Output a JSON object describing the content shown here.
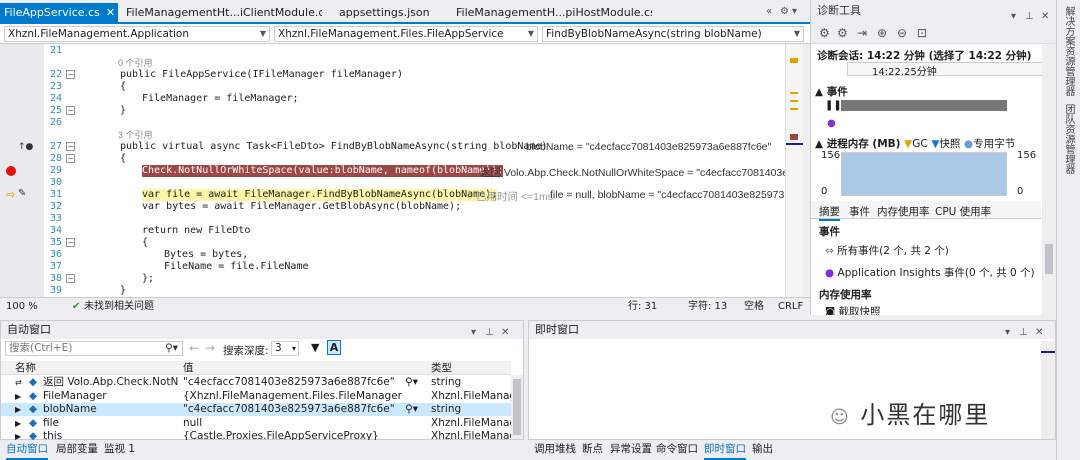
{
  "tabs": [
    {
      "label": "FileAppService.cs",
      "active": true
    },
    {
      "label": "FileManagementHt...iClientModule.cs",
      "active": false
    },
    {
      "label": "appsettings.json",
      "active": false
    },
    {
      "label": "FileManagementH...piHostModule.cs",
      "active": false
    }
  ],
  "tab_controls": [
    "«",
    "⚙",
    "▾",
    "⊞"
  ],
  "nav": {
    "project": "Xhznl.FileManagement.Application",
    "class": "Xhznl.FileManagement.Files.FileAppService",
    "member": "FindByBlobNameAsync(string blobName)"
  },
  "lines": [
    {
      "n": "21",
      "t": ""
    },
    {
      "n": "",
      "t": "0 个引用",
      "cls": "cm"
    },
    {
      "n": "22",
      "t": "public FileAppService(IFileManager fileManager)"
    },
    {
      "n": "23",
      "t": "{"
    },
    {
      "n": "24",
      "t": "    FileManager = fileManager;"
    },
    {
      "n": "25",
      "t": "}"
    },
    {
      "n": "26",
      "t": ""
    },
    {
      "n": "",
      "t": "3 个引用",
      "cls": "cm"
    },
    {
      "n": "27",
      "t": "public virtual async Task<FileDto> FindByBlobNameAsync(string blobName)"
    },
    {
      "n": "28",
      "t": "{"
    },
    {
      "n": "29",
      "t": "    Check.NotNullOrWhiteSpace(value:blobName, nameof(blobName));"
    },
    {
      "n": "30",
      "t": ""
    },
    {
      "n": "31",
      "t": "    var file = await FileManager.FindByBlobNameAsync(blobName);"
    },
    {
      "n": "32",
      "t": "    var bytes = await FileManager.GetBlobAsync(blobName);"
    },
    {
      "n": "33",
      "t": ""
    },
    {
      "n": "34",
      "t": "    return new FileDto"
    },
    {
      "n": "35",
      "t": "    {"
    },
    {
      "n": "36",
      "t": "        Bytes = bytes,"
    },
    {
      "n": "37",
      "t": "        FileName = file.FileName"
    },
    {
      "n": "38",
      "t": "    };"
    },
    {
      "n": "39",
      "t": "}"
    }
  ],
  "datatips": {
    "line27": "blobName = \"c4ecfacc7081403e825973a6e887fc6e\"",
    "line29": "返回 Volo.Abp.Check.NotNullOrWhiteSpace = \"c4ecfacc7081403e82",
    "line31_time": "已用时间 <=1ms",
    "line31": "file = null,  blobName = \"c4ecfacc7081403e825973"
  },
  "status": {
    "zoom": "100 %",
    "issues": "未找到相关问题",
    "row": "行: 31",
    "char": "字符: 13",
    "space": "空格",
    "eol": "CRLF"
  },
  "diag": {
    "title": "诊断工具",
    "session": "诊断会话: 14:22 分钟 (选择了 14:22 分钟)",
    "time_label": "14:22.25分钟",
    "events_label": "事件",
    "memory_label": "进程内存 (MB)",
    "legend_gc": "GC",
    "legend_snapshot": "快照",
    "legend_private": "专用字节",
    "mem_left": "156",
    "mem_right": "156",
    "mem_bottom_left": "0",
    "mem_bottom_right": "0",
    "subtabs": [
      "摘要",
      "事件",
      "内存使用率",
      "CPU 使用率"
    ],
    "section_events": "事件",
    "all_events": "所有事件(2 个, 共 2 个)",
    "app_insights": "Application Insights 事件(0 个, 共 0 个)",
    "section_memory": "内存使用率",
    "snapshot": "截取快照"
  },
  "right_sidebar": [
    "解决方案资源管理器",
    "团队资源管理器"
  ],
  "autos": {
    "title": "自动窗口",
    "search_placeholder": "搜索(Ctrl+E)",
    "depth_label": "搜索深度:",
    "depth_value": "3",
    "columns": [
      "名称",
      "值",
      "类型"
    ],
    "rows": [
      {
        "name": "返回 Volo.Abp.Check.NotNull...",
        "value": "\"c4ecfacc7081403e825973a6e887fc6e\"",
        "type": "string"
      },
      {
        "name": "FileManager",
        "value": "{Xhznl.FileManagement.Files.FileManager}",
        "type": "Xhznl.FileManag..."
      },
      {
        "name": "blobName",
        "value": "\"c4ecfacc7081403e825973a6e887fc6e\"",
        "type": "string"
      },
      {
        "name": "file",
        "value": "null",
        "type": "Xhznl.FileManag..."
      },
      {
        "name": "this",
        "value": "{Castle.Proxies.FileAppServiceProxy}",
        "type": "Xhznl.FileManag..."
      }
    ],
    "bottom_tabs": [
      "自动窗口",
      "局部变量",
      "监视 1"
    ]
  },
  "immediate": {
    "title": "即时窗口",
    "bottom_tabs": [
      "调用堆栈",
      "断点",
      "异常设置",
      "命令窗口",
      "即时窗口",
      "输出"
    ]
  },
  "watermark": "小黑在哪里"
}
